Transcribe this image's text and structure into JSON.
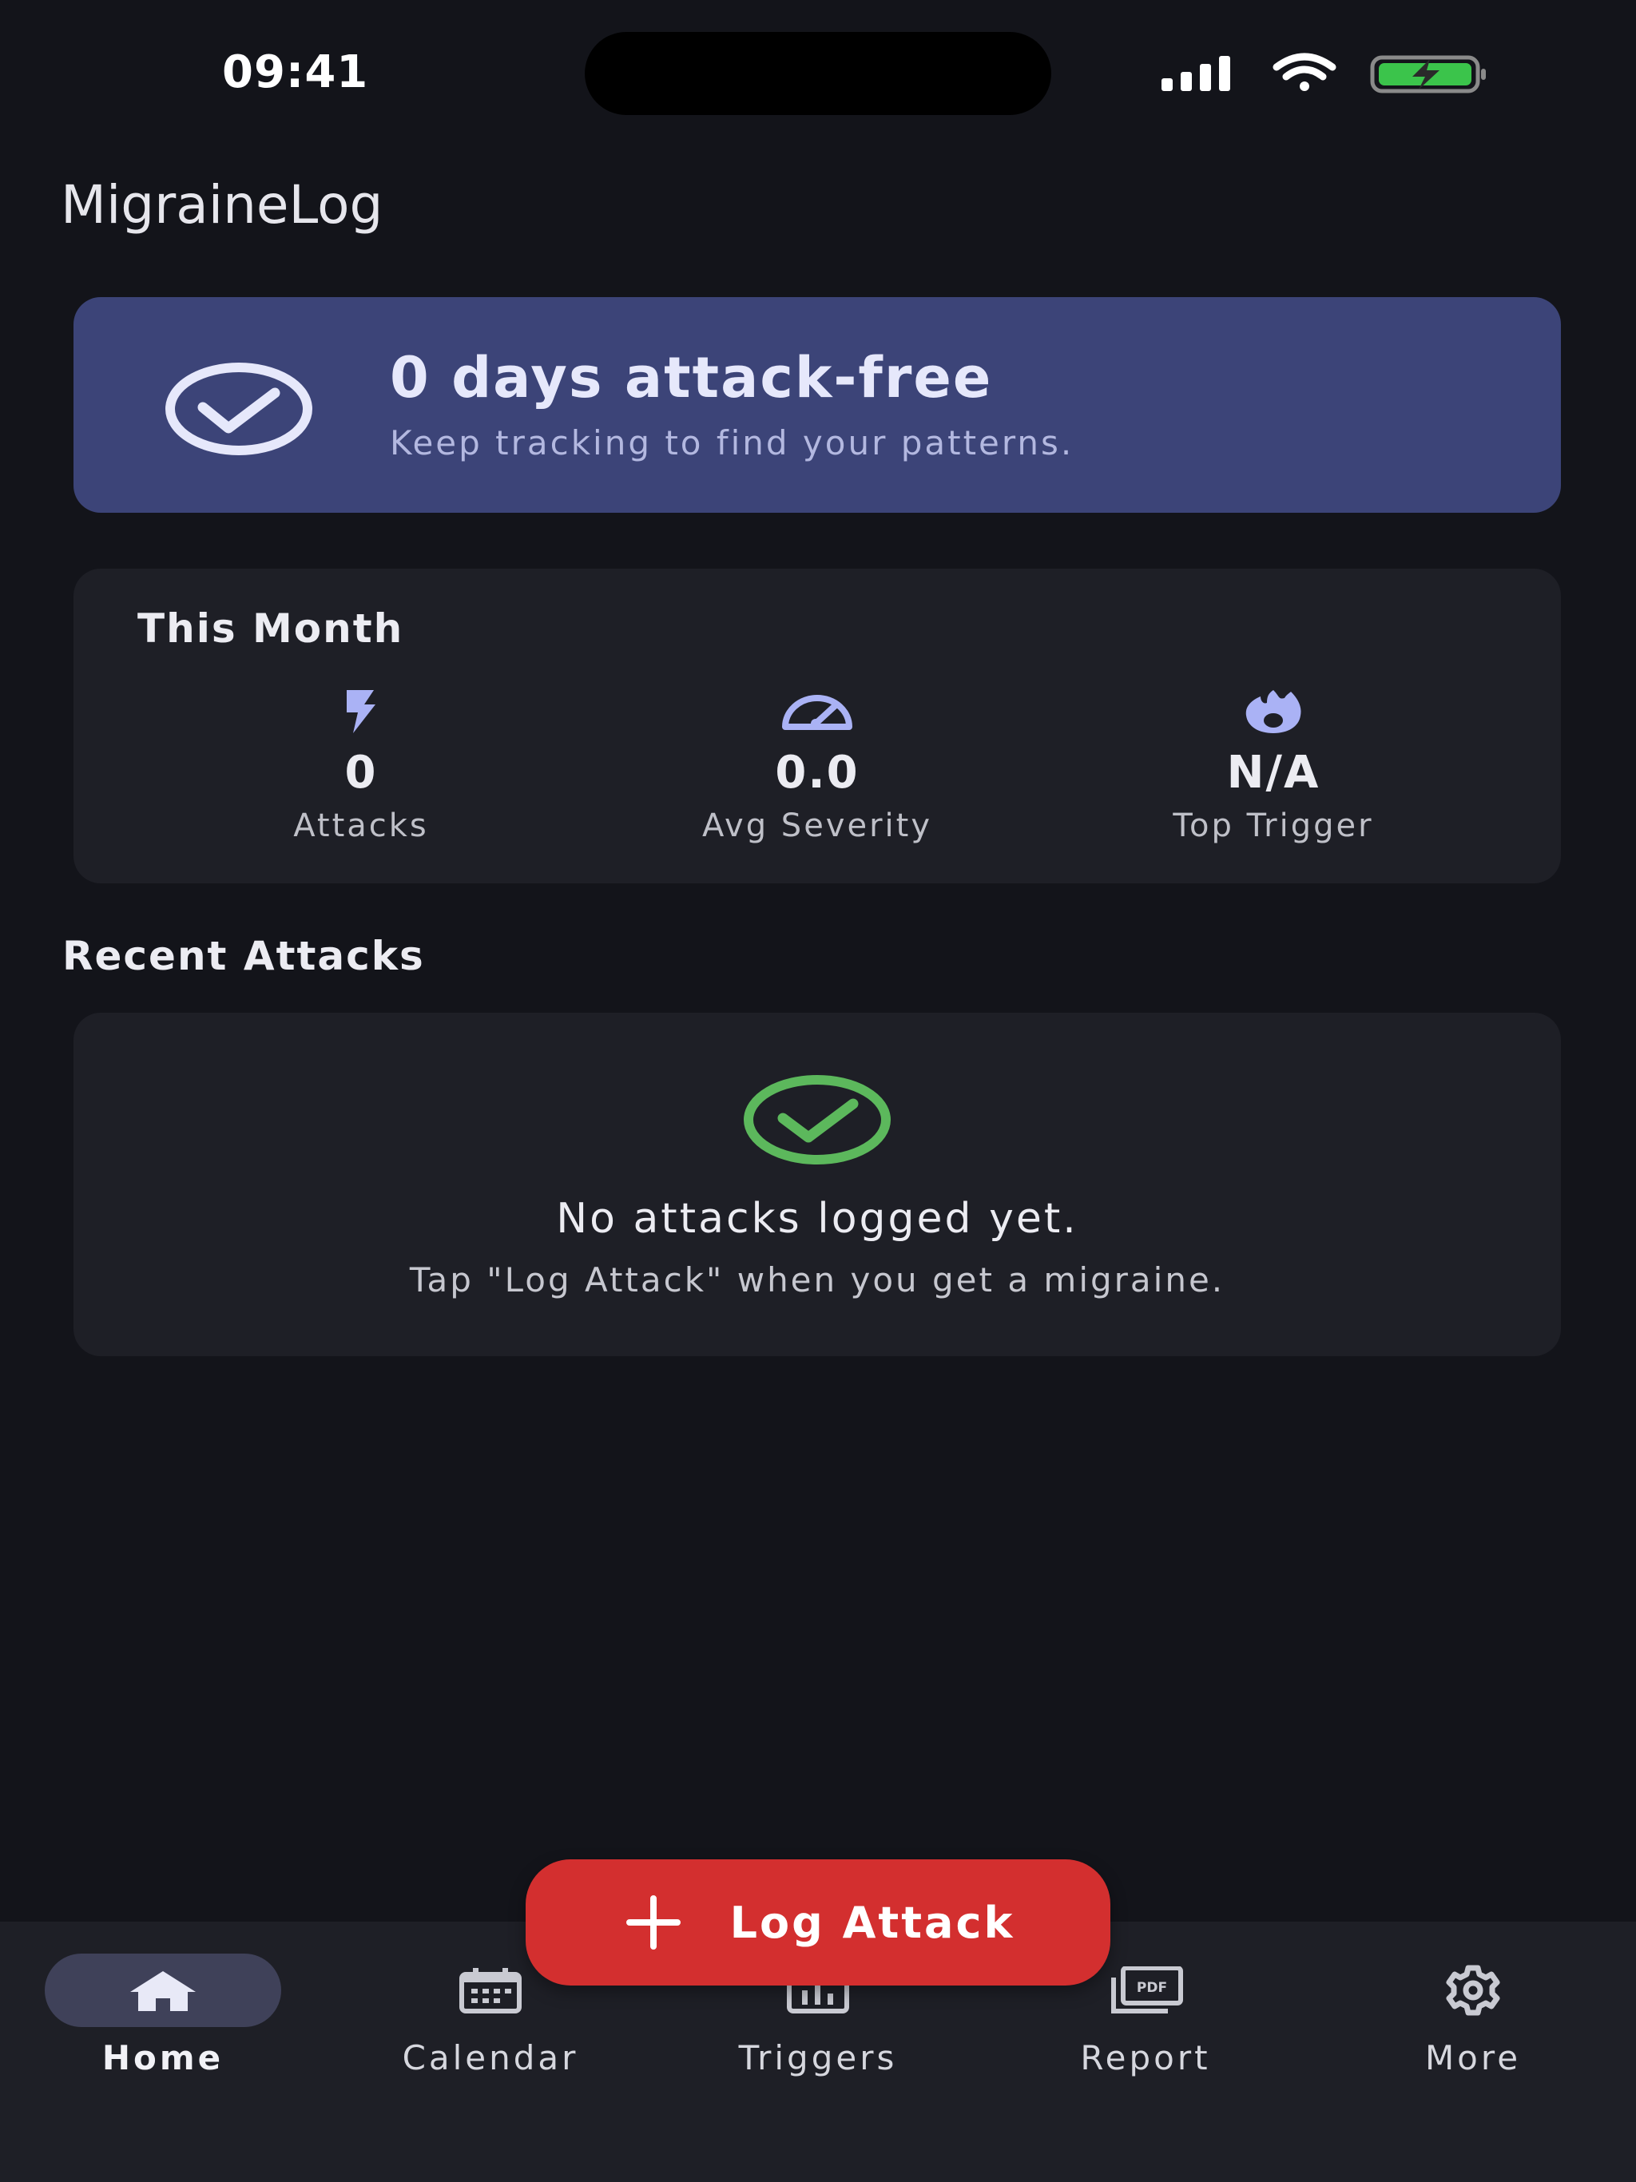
{
  "status_bar": {
    "time": "09:41",
    "icons": [
      "cellular-signal-icon",
      "wifi-icon",
      "battery-charging-icon"
    ]
  },
  "header": {
    "title": "MigraineLog"
  },
  "streak_banner": {
    "title": "0 days attack-free",
    "subtitle": "Keep tracking to find your patterns.",
    "icon": "check-circle-icon"
  },
  "this_month": {
    "title": "This Month",
    "stats": [
      {
        "icon": "lightning-bolt-icon",
        "value": "0",
        "label": "Attacks"
      },
      {
        "icon": "speedometer-icon",
        "value": "0.0",
        "label": "Avg Severity"
      },
      {
        "icon": "fire-icon",
        "value": "N/A",
        "label": "Top Trigger"
      }
    ]
  },
  "recent_attacks": {
    "title": "Recent Attacks",
    "empty_title": "No attacks logged yet.",
    "empty_subtitle": "Tap \"Log Attack\" when you get a migraine.",
    "empty_icon": "check-circle-icon"
  },
  "fab": {
    "label": "Log Attack",
    "icon": "plus-icon"
  },
  "bottom_nav": {
    "items": [
      {
        "label": "Home",
        "icon": "home-icon",
        "active": true
      },
      {
        "label": "Calendar",
        "icon": "calendar-icon",
        "active": false
      },
      {
        "label": "Triggers",
        "icon": "bar-chart-icon",
        "active": false
      },
      {
        "label": "Report",
        "icon": "pdf-icon",
        "active": false
      },
      {
        "label": "More",
        "icon": "gear-icon",
        "active": false
      }
    ]
  },
  "colors": {
    "background": "#13141a",
    "card": "#1e1f26",
    "banner": "#3c4478",
    "accent": "#aab2f5",
    "success": "#5cb85c",
    "fab": "#d32f2f"
  }
}
